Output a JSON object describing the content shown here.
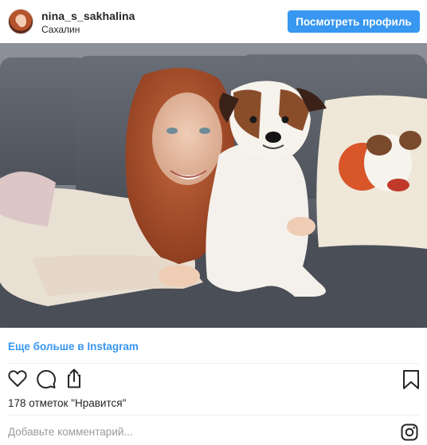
{
  "header": {
    "username": "nina_s_sakhalina",
    "location": "Сахалин",
    "view_profile_label": "Посмотреть профиль"
  },
  "post": {
    "more_link": "Еще больше в Instagram",
    "likes_text": "178 отметок \"Нравится\"",
    "comment_placeholder": "Добавьте комментарий..."
  },
  "icons": {
    "like": "heart-icon",
    "comment": "comment-icon",
    "share": "share-icon",
    "save": "bookmark-icon",
    "brand": "instagram-icon"
  },
  "colors": {
    "accent": "#3897f0",
    "text": "#262626",
    "placeholder": "#9a9a9a"
  }
}
